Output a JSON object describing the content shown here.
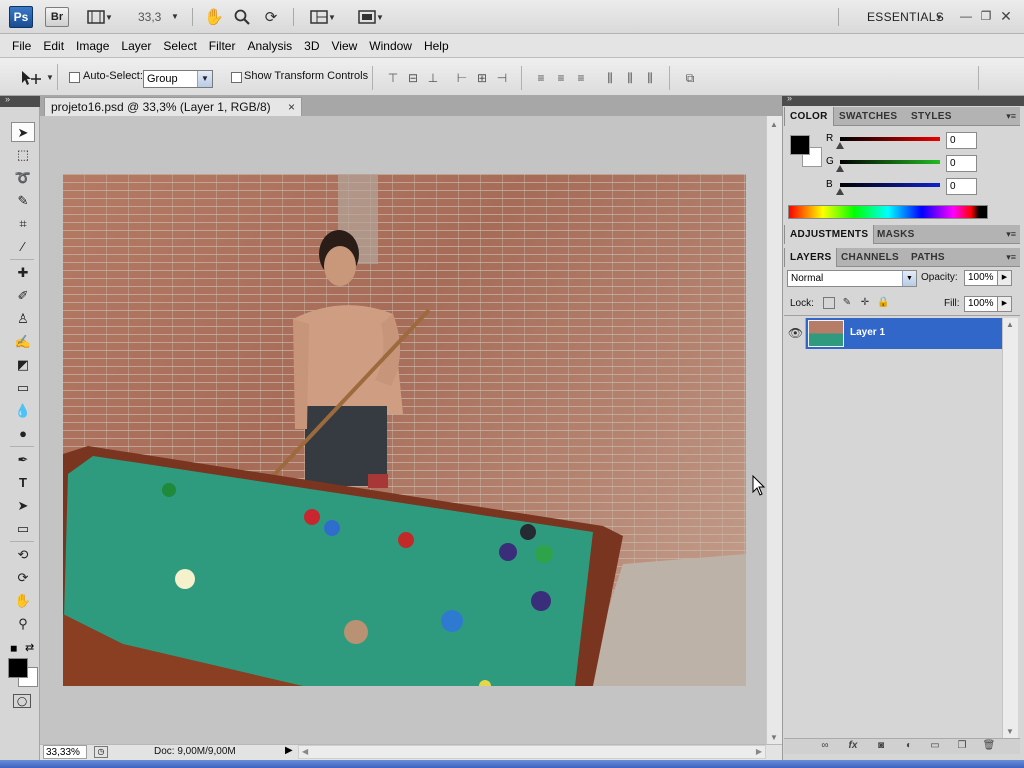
{
  "appbar": {
    "ps_logo": "Ps",
    "br_logo": "Br",
    "zoom": "33,3",
    "workspace": "ESSENTIALS"
  },
  "menu": [
    "File",
    "Edit",
    "Image",
    "Layer",
    "Select",
    "Filter",
    "Analysis",
    "3D",
    "View",
    "Window",
    "Help"
  ],
  "options": {
    "auto_select_label": "Auto-Select:",
    "auto_select_value": "Group",
    "show_transform_label": "Show Transform Controls"
  },
  "document": {
    "tab_title": "projeto16.psd @ 33,3% (Layer 1, RGB/8)",
    "tab_close": "×",
    "status_zoom": "33,33%",
    "status_doc": "Doc: 9,00M/9,00M"
  },
  "color_panel": {
    "tabs": [
      "COLOR",
      "SWATCHES",
      "STYLES"
    ],
    "active_tab": "COLOR",
    "channels": [
      {
        "label": "R",
        "value": "0",
        "color": "#d01010"
      },
      {
        "label": "G",
        "value": "0",
        "color": "#20a020"
      },
      {
        "label": "B",
        "value": "0",
        "color": "#1020c0"
      }
    ],
    "foreground": "#000000",
    "background": "#ffffff"
  },
  "adjustments_panel": {
    "tabs": [
      "ADJUSTMENTS",
      "MASKS"
    ]
  },
  "layers_panel": {
    "tabs": [
      "LAYERS",
      "CHANNELS",
      "PATHS"
    ],
    "blend_mode": "Normal",
    "opacity_label": "Opacity:",
    "opacity": "100%",
    "lock_label": "Lock:",
    "fill_label": "Fill:",
    "fill": "100%",
    "layers": [
      {
        "name": "Layer 1",
        "selected": true,
        "visible": true
      }
    ]
  }
}
